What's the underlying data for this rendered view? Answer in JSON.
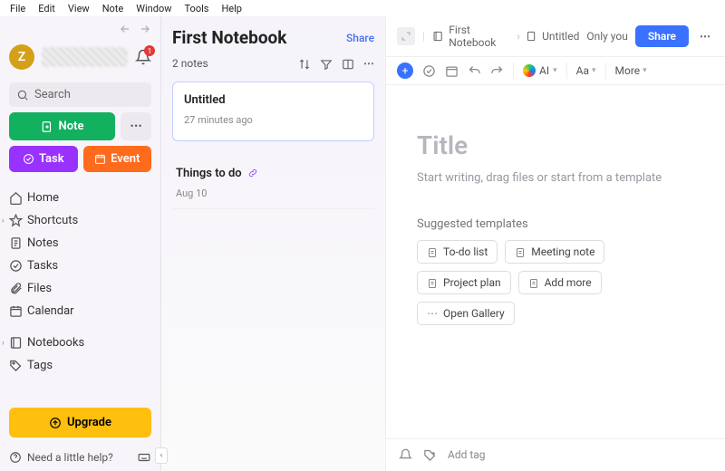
{
  "menubar": [
    "File",
    "Edit",
    "View",
    "Note",
    "Window",
    "Tools",
    "Help"
  ],
  "sidebar": {
    "avatar_initial": "Z",
    "badge": "1",
    "search_placeholder": "Search",
    "btn_note": "Note",
    "btn_task": "Task",
    "btn_event": "Event",
    "items": [
      {
        "icon": "home",
        "label": "Home"
      },
      {
        "icon": "star",
        "label": "Shortcuts",
        "exp": true
      },
      {
        "icon": "note",
        "label": "Notes"
      },
      {
        "icon": "check",
        "label": "Tasks"
      },
      {
        "icon": "clip",
        "label": "Files"
      },
      {
        "icon": "cal",
        "label": "Calendar"
      }
    ],
    "items2": [
      {
        "icon": "book",
        "label": "Notebooks",
        "exp": true
      },
      {
        "icon": "tag",
        "label": "Tags"
      }
    ],
    "upgrade": "Upgrade",
    "help": "Need a little help?"
  },
  "list": {
    "title": "First Notebook",
    "share": "Share",
    "count": "2 notes",
    "notes": [
      {
        "title": "Untitled",
        "date": "27 minutes ago",
        "selected": true
      },
      {
        "title": "Things to do",
        "date": "Aug 10",
        "selected": false,
        "icon": "link"
      }
    ]
  },
  "editor": {
    "breadcrumb_notebook": "First Notebook",
    "breadcrumb_note": "Untitled",
    "privacy": "Only you",
    "share_btn": "Share",
    "ai_label": "AI",
    "aa_label": "Aa",
    "more_label": "More",
    "title_placeholder": "Title",
    "body_placeholder": "Start writing, drag files or start from a template",
    "templates_header": "Suggested templates",
    "chips": [
      "To-do list",
      "Meeting note",
      "Project plan",
      "Add more",
      "Open Gallery"
    ],
    "add_tag": "Add tag"
  }
}
